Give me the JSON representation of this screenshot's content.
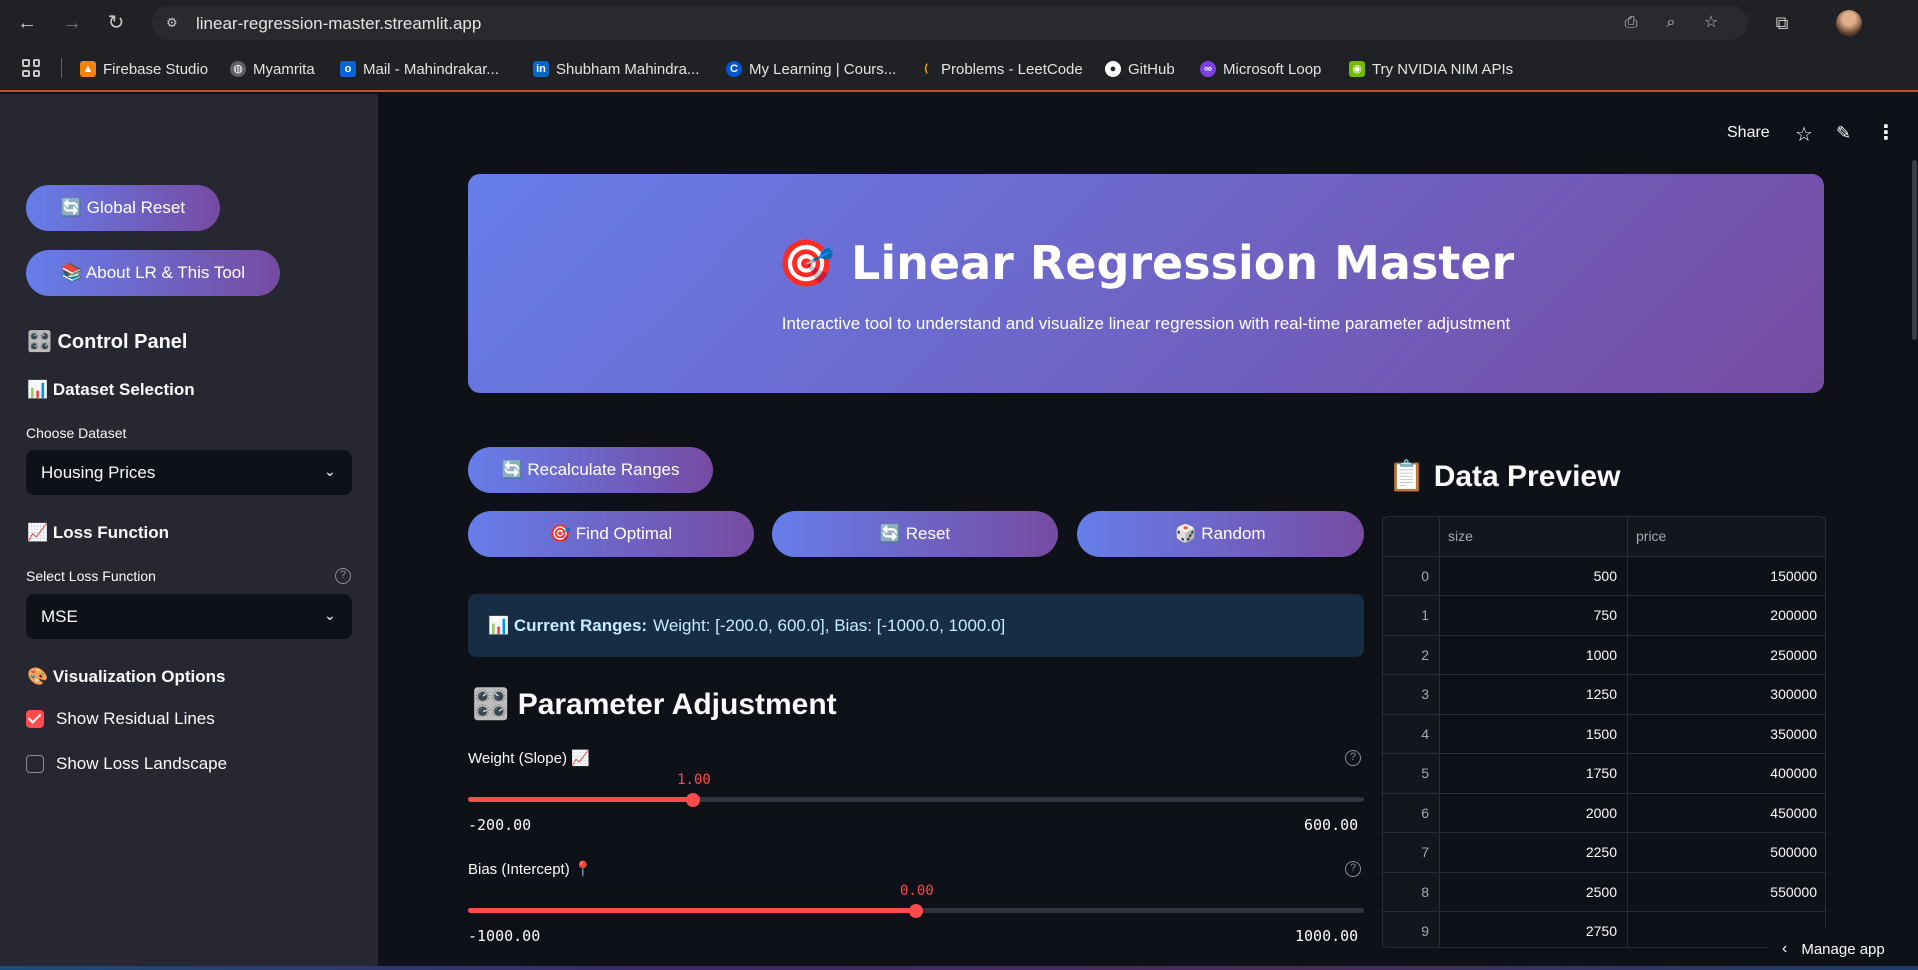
{
  "browser": {
    "url": "linear-regression-master.streamlit.app",
    "bookmarks": [
      {
        "label": "Firebase Studio",
        "color": "#f5820d"
      },
      {
        "label": "Myamrita",
        "color": "#6b7280"
      },
      {
        "label": "Mail - Mahindrakar...",
        "color": "#0a64d6"
      },
      {
        "label": "Shubham Mahindra...",
        "color": "#0a66c2"
      },
      {
        "label": "My Learning | Cours...",
        "color": "#0056d2"
      },
      {
        "label": "Problems - LeetCode",
        "color": "#ffa116"
      },
      {
        "label": "GitHub",
        "color": "#24292f"
      },
      {
        "label": "Microsoft Loop",
        "color": "#7b3fe4"
      },
      {
        "label": "Try NVIDIA NIM APIs",
        "color": "#76b900"
      }
    ]
  },
  "sidebar": {
    "global_reset": "🔄 Global Reset",
    "about": "📚 About LR & This Tool",
    "control_panel": "🎛️ Control Panel",
    "dataset_section": "📊 Dataset Selection",
    "dataset_label": "Choose Dataset",
    "dataset_value": "Housing Prices",
    "loss_section": "📈 Loss Function",
    "loss_label": "Select Loss Function",
    "loss_value": "MSE",
    "viz_section": "🎨 Visualization Options",
    "show_residual": "Show Residual Lines",
    "show_residual_checked": true,
    "show_landscape": "Show Loss Landscape",
    "show_landscape_checked": false
  },
  "header": {
    "share": "Share"
  },
  "hero": {
    "title": "🎯 Linear Regression Master",
    "subtitle": "Interactive tool to understand and visualize linear regression with real-time parameter adjustment"
  },
  "actions": {
    "recalculate": "🔄 Recalculate Ranges",
    "find_optimal": "🎯 Find Optimal",
    "reset": "🔄 Reset",
    "random": "🎲 Random"
  },
  "ranges": {
    "label": "📊 Current Ranges:",
    "text": "Weight: [-200.0, 600.0], Bias: [-1000.0, 1000.0]"
  },
  "params": {
    "title": "🎛️ Parameter Adjustment",
    "weight": {
      "label": "Weight (Slope) 📈",
      "value": "1.00",
      "min": "-200.00",
      "max": "600.00",
      "fraction": 0.25125
    },
    "bias": {
      "label": "Bias (Intercept) 📍",
      "value": "0.00",
      "min": "-1000.00",
      "max": "1000.00",
      "fraction": 0.5
    }
  },
  "preview": {
    "title": "📋 Data Preview",
    "columns": [
      "",
      "size",
      "price"
    ],
    "rows": [
      [
        "0",
        "500",
        "150000"
      ],
      [
        "1",
        "750",
        "200000"
      ],
      [
        "2",
        "1000",
        "250000"
      ],
      [
        "3",
        "1250",
        "300000"
      ],
      [
        "4",
        "1500",
        "350000"
      ],
      [
        "5",
        "1750",
        "400000"
      ],
      [
        "6",
        "2000",
        "450000"
      ],
      [
        "7",
        "2250",
        "500000"
      ],
      [
        "8",
        "2500",
        "550000"
      ],
      [
        "9",
        "2750",
        ""
      ]
    ]
  },
  "footer": {
    "manage_app": "Manage app"
  }
}
